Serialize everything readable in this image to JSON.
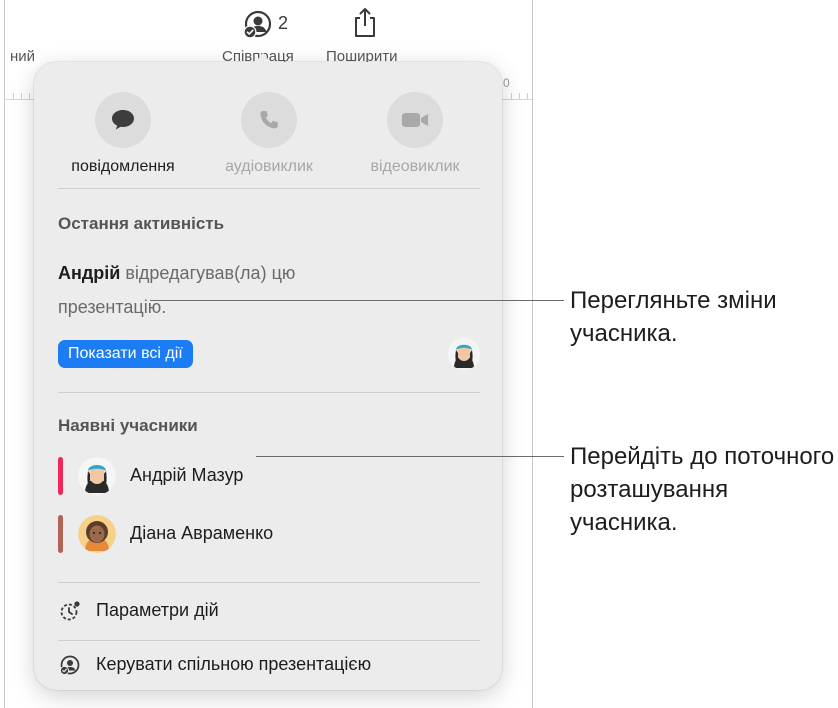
{
  "toolbar": {
    "left_label": "ний",
    "collab_count": "2",
    "collab_label": "Співпраця",
    "share_label": "Поширити",
    "ruler_number": "0"
  },
  "comm": {
    "message_label": "повідомлення",
    "audio_label": "аудіовиклик",
    "video_label": "відеовиклик"
  },
  "activity": {
    "title": "Остання активність",
    "actor": "Андрій",
    "text": " відредагував(ла) цю презентацію.",
    "show_all_label": "Показати всі дії"
  },
  "participants": {
    "title": "Наявні учасники",
    "items": [
      {
        "name": "Андрій Мазур",
        "color": "#f0285a"
      },
      {
        "name": "Діана Авраменко",
        "color": "#b06458"
      }
    ]
  },
  "menu": {
    "activity_settings": "Параметри дій",
    "manage": "Керувати спільною презентацією"
  },
  "callouts": {
    "changes": "Перегляньте зміни учасника.",
    "location": "Перейдіть до поточного розташування учасника."
  },
  "colors": {
    "accent": "#1b7cf4",
    "popover_bg": "#ececec"
  }
}
